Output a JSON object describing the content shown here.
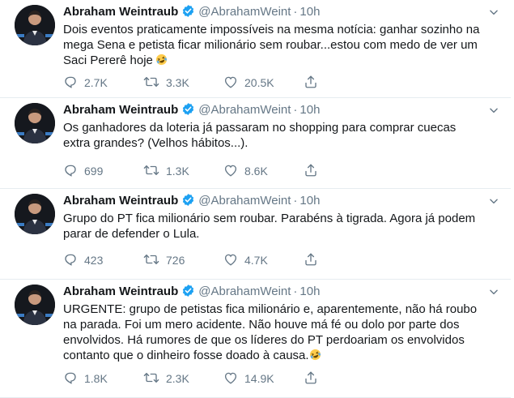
{
  "tweets": [
    {
      "name": "Abraham Weintraub",
      "handle": "@AbrahamWeint",
      "separator": "·",
      "time": "10h",
      "text_lines": [
        "Dois eventos praticamente impossíveis na mesma notícia: ganhar sozinho na",
        "mega Sena e petista ficar milionário sem roubar...estou com medo de ver um",
        "Saci Pererê hoje"
      ],
      "has_emoji": true,
      "replies": "2.7K",
      "retweets": "3.3K",
      "likes": "20.5K"
    },
    {
      "name": "Abraham Weintraub",
      "handle": "@AbrahamWeint",
      "separator": "·",
      "time": "10h",
      "text_lines": [
        "Os ganhadores da loteria já passaram no shopping para comprar cuecas",
        "extra grandes? (Velhos hábitos...)."
      ],
      "has_emoji": false,
      "replies": "699",
      "retweets": "1.3K",
      "likes": "8.6K"
    },
    {
      "name": "Abraham Weintraub",
      "handle": "@AbrahamWeint",
      "separator": "·",
      "time": "10h",
      "text_lines": [
        "Grupo do PT fica milionário sem roubar. Parabéns à tigrada. Agora já podem",
        "parar de defender o Lula."
      ],
      "has_emoji": false,
      "replies": "423",
      "retweets": "726",
      "likes": "4.7K"
    },
    {
      "name": "Abraham Weintraub",
      "handle": "@AbrahamWeint",
      "separator": "·",
      "time": "10h",
      "text_lines": [
        "URGENTE: grupo de petistas fica milionário e, aparentemente, não há roubo",
        "na parada. Foi um mero acidente. Não houve má fé ou dolo por parte dos",
        "envolvidos. Há rumores de que os líderes do PT perdoariam os envolvidos",
        "contanto que o dinheiro fosse doado à causa."
      ],
      "has_emoji": true,
      "replies": "1.8K",
      "retweets": "2.3K",
      "likes": "14.9K"
    }
  ],
  "colors": {
    "verified": "#1da1f2",
    "muted": "#657786",
    "text": "#14171a",
    "divider": "#e6ecf0"
  },
  "icons": [
    "verified-badge-icon",
    "chevron-down-icon",
    "reply-icon",
    "retweet-icon",
    "like-icon",
    "share-icon",
    "rofl-emoji-icon"
  ]
}
